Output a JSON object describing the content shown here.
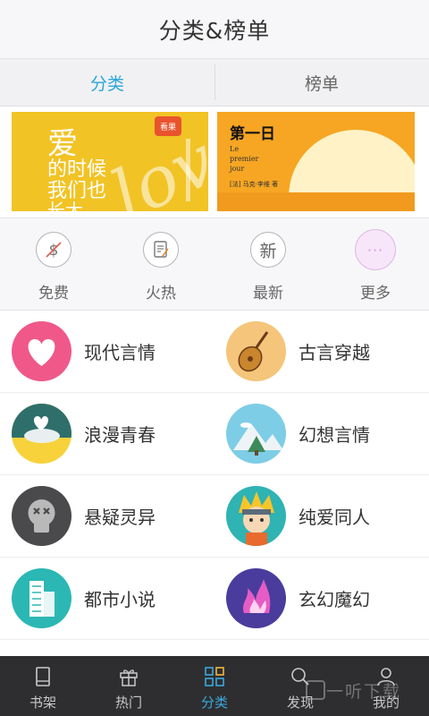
{
  "header": {
    "title": "分类&榜单"
  },
  "tabs": [
    {
      "label": "分类",
      "active": true
    },
    {
      "label": "榜单",
      "active": false
    }
  ],
  "banners": [
    {
      "title_lines": [
        "爱",
        "的时候",
        "我们也",
        "长大"
      ],
      "badge": "看果",
      "script": "love"
    },
    {
      "title": "第一日",
      "subtitle": "Le\npremier\njour",
      "author": "[法] 马克·李维 著"
    }
  ],
  "quick_links": [
    {
      "label": "免费",
      "icon": "free-icon"
    },
    {
      "label": "火热",
      "icon": "hot-icon"
    },
    {
      "label": "最新",
      "icon": "new-icon",
      "glyph": "新"
    },
    {
      "label": "更多",
      "icon": "more-icon",
      "glyph": "···"
    }
  ],
  "categories": [
    {
      "label": "现代言情",
      "icon": "heart-icon"
    },
    {
      "label": "古言穿越",
      "icon": "pipa-icon"
    },
    {
      "label": "浪漫青春",
      "icon": "heart-cloud-icon"
    },
    {
      "label": "幻想言情",
      "icon": "mountain-icon"
    },
    {
      "label": "悬疑灵异",
      "icon": "skull-icon"
    },
    {
      "label": "纯爱同人",
      "icon": "ninja-icon"
    },
    {
      "label": "都市小说",
      "icon": "building-icon"
    },
    {
      "label": "玄幻魔幻",
      "icon": "flame-icon"
    }
  ],
  "tabbar": [
    {
      "label": "书架",
      "icon": "bookshelf-icon",
      "active": false
    },
    {
      "label": "热门",
      "icon": "gift-icon",
      "active": false
    },
    {
      "label": "分类",
      "icon": "grid-icon",
      "active": true
    },
    {
      "label": "发现",
      "icon": "search-icon",
      "active": false
    },
    {
      "label": "我的",
      "icon": "user-icon",
      "active": false
    }
  ],
  "watermark": "一听下载",
  "colors": {
    "accent": "#2aa6d8",
    "tabbar_bg": "#2e2e30",
    "banner_yellow": "#f2c325",
    "banner_orange": "#f6a623"
  }
}
